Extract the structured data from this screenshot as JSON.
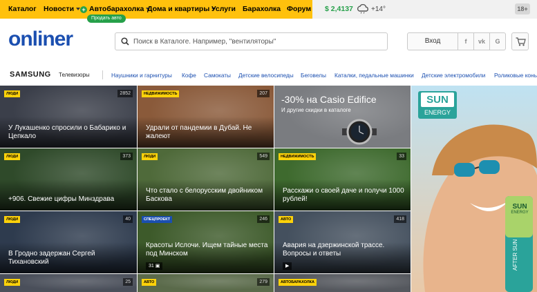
{
  "topnav": {
    "items": [
      "Каталог",
      "Новости",
      "Автобарахолка",
      "Дома и квартиры",
      "Услуги",
      "Барахолка",
      "Форум"
    ],
    "sell_badge": "Продать авто",
    "rate": "$ 2,4137",
    "temperature": "+14°",
    "age": "18+",
    "weather_icon": "cloud-rain-icon"
  },
  "header": {
    "logo": "onliner",
    "search_placeholder": "Поиск в Каталоге. Например, \"вентиляторы\"",
    "login": "Вход",
    "social": [
      "f",
      "vk",
      "G"
    ]
  },
  "categories": {
    "brand": "SAMSUNG",
    "brand_sub": "Телевизоры",
    "links": [
      "Наушники и гарнитуры",
      "Кофе",
      "Самокаты",
      "Детские велосипеды",
      "Беговелы",
      "Каталки, педальные машинки",
      "Детские электромобили",
      "Роликовые коньки"
    ]
  },
  "tiles": [
    {
      "tag": "Люди",
      "count": "2852",
      "title": "У Лукашенко спросили о Бабарико и Цепкало",
      "color": "#3b3f4a"
    },
    {
      "tag": "Недвижимость",
      "count": "207",
      "title": "Удрали от пандемии в Дубай. Не жалеют",
      "color": "#8a5a3a"
    },
    {
      "promo_title": "-30% на Casio Edifice",
      "promo_sub": "И другие скидки в каталоге",
      "color": "#7a7c80"
    },
    {
      "tag": "Люди",
      "count": "373",
      "title": "+906. Свежие цифры Минздрава",
      "color": "#2f4a2a"
    },
    {
      "tag": "Люди",
      "count": "549",
      "title": "Что стало с белорусским двойником Баскова",
      "color": "#4f6a3a"
    },
    {
      "tag": "Недвижимость",
      "count": "33",
      "title": "Расскажи о своей даче и получи 1000 рублей!",
      "color": "#3e6a2e"
    },
    {
      "tag": "Люди",
      "count": "40",
      "title": "В Гродно задержан Сергей Тихановский",
      "color": "#2e3b4e"
    },
    {
      "tag": "Спецпроект",
      "count": "246",
      "title": "Красоты Ислочи. Ищем тайные места под Минском",
      "photos": "31",
      "color": "#3d5a2a"
    },
    {
      "tag": "Авто",
      "count": "418",
      "title": "Авария на дзержинской трассе. Вопросы и ответы",
      "color": "#44505e"
    },
    {
      "tag": "Люди",
      "count": "25",
      "title": "",
      "color": "#4a4f5a"
    },
    {
      "tag": "Авто",
      "count": "279",
      "title": "",
      "color": "#5a6a4a"
    },
    {
      "tag": "Автобарахолка",
      "count": "",
      "title": "",
      "color": "#55585e"
    }
  ],
  "ad": {
    "brand": "SUN",
    "sub": "ENERGY",
    "pack_brand": "SUN",
    "pack_sub": "ENERGY",
    "pack_text": "AFTER SUN"
  }
}
